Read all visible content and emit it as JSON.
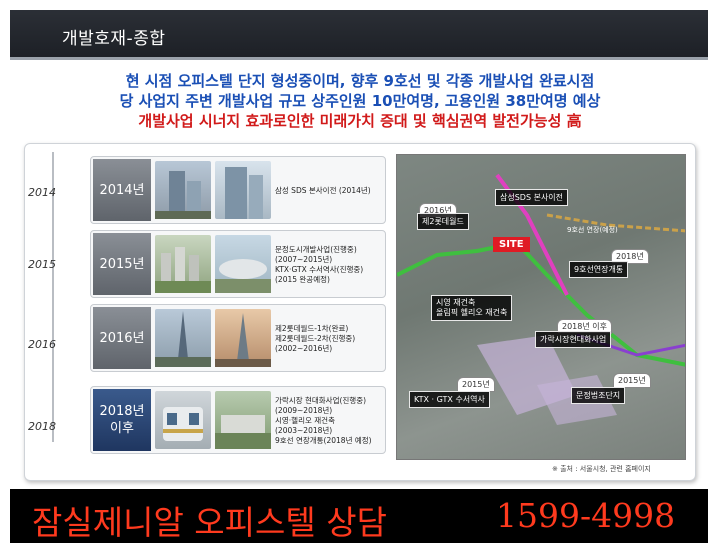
{
  "header": {
    "title": "개발호재-종합"
  },
  "headline": {
    "line1": "현 시점 오피스텔 단지 형성중이며, 향후 9호선 및 각종 개발사업 완료시점",
    "line2": "당 사업지 주변 개발사업 규모 상주인원 10만여명, 고용인원 38만여명 예상",
    "line3": "개발사업 시너지 효과로인한 미래가치 증대 및 핵심권역 발전가능성 高"
  },
  "timeline": {
    "years": [
      "2014",
      "2015",
      "2016",
      "2018"
    ],
    "rows": [
      {
        "year": "2014년",
        "desc": "삼성 SDS 본사이전 (2014년)"
      },
      {
        "year": "2015년",
        "desc": "문정도시개발사업(진행중)\n(2007~2015년)\nKTX·GTX 수서역사(진행중)\n(2015 완공예정)"
      },
      {
        "year": "2016년",
        "desc": "제2롯데월드-1차(완료)\n제2롯데월드-2차(진행중)\n(2002~2016년)"
      },
      {
        "year": "2018년\n이후",
        "desc": "가락시장 현대화사업(진행중)\n(2009~2018년)\n시영·헬리오 재건축\n(2003~2018년)\n9호선 연장개통(2018년 예정)"
      }
    ]
  },
  "map": {
    "labels": [
      {
        "year": "2016년",
        "text": "제2롯데월드"
      },
      {
        "year": "",
        "text": "삼성SDS 본사이전"
      },
      {
        "year": "",
        "text": "SITE"
      },
      {
        "year": "2018년",
        "text": "9호선연장개통"
      },
      {
        "year": "",
        "text": "시영 재건축\n올림픽 헬리오 재건축"
      },
      {
        "year": "2018년 이후",
        "text": "가락시장현대화사업"
      },
      {
        "year": "2015년",
        "text": "KTX · GTX 수서역사"
      },
      {
        "year": "2015년",
        "text": "문정법조단지"
      }
    ],
    "line_note": "9호선 연장(예정)"
  },
  "source": "※ 출처 : 서울시청, 관련 홈페이지",
  "footer": {
    "text": "잠실제니알 오피스텔 상담",
    "phone": "1599-4998"
  },
  "colors": {
    "headline_blue": "#1a4fb5",
    "headline_red": "#d11a1a",
    "footer_text": "#ff3a1e"
  }
}
